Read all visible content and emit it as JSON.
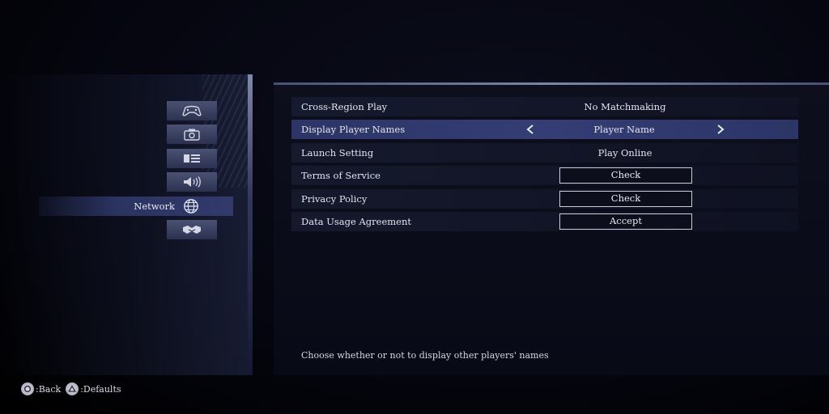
{
  "sidebar": {
    "categories": [
      {
        "icon": "controller-icon"
      },
      {
        "icon": "camera-icon"
      },
      {
        "icon": "display-icon"
      },
      {
        "icon": "speaker-icon"
      },
      {
        "icon": "globe-icon",
        "label": "Network",
        "active": true
      },
      {
        "icon": "handshake-icon"
      }
    ],
    "active_label": "Network"
  },
  "settings": [
    {
      "label": "Cross-Region Play",
      "value": "No Matchmaking",
      "kind": "value"
    },
    {
      "label": "Display Player Names",
      "value": "Player Name",
      "kind": "selector",
      "selected": true
    },
    {
      "label": "Launch Setting",
      "value": "Play Online",
      "kind": "value"
    },
    {
      "label": "Terms of Service",
      "value": "Check",
      "kind": "button"
    },
    {
      "label": "Privacy Policy",
      "value": "Check",
      "kind": "button"
    },
    {
      "label": "Data Usage Agreement",
      "value": "Accept",
      "kind": "button"
    }
  ],
  "description": "Choose whether or not to display other players' names",
  "footer": {
    "back_label": ":Back",
    "defaults_label": ":Defaults",
    "back_icon": "circle-button-icon",
    "defaults_icon": "triangle-button-icon"
  },
  "colors": {
    "selected_row": "#343e74",
    "panel_bg": "#0a0c18",
    "accent_edge": "#9aa2cc"
  }
}
